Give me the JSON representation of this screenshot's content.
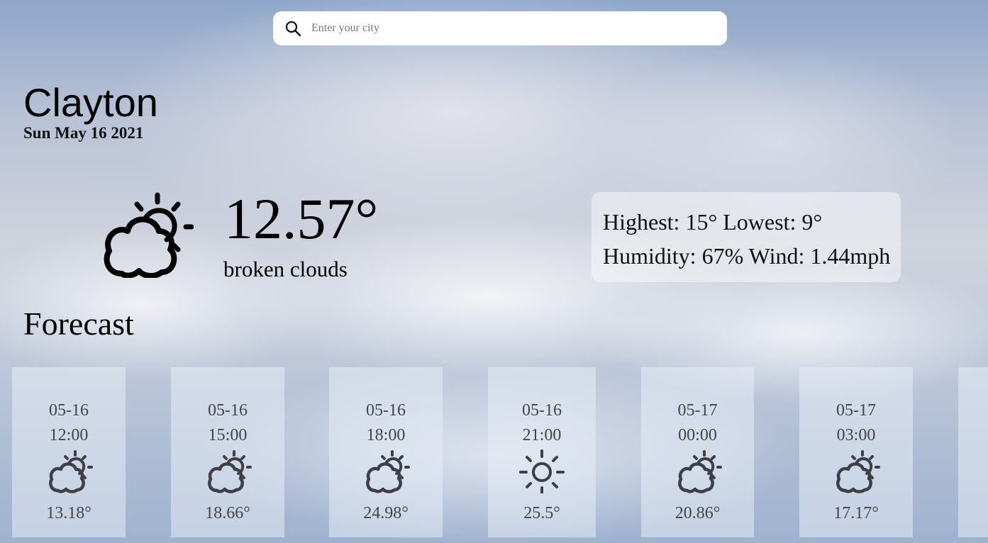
{
  "search": {
    "placeholder": "Enter your city",
    "icon": "search-icon"
  },
  "current": {
    "city": "Clayton",
    "date": "Sun May 16 2021",
    "temperature": "12.57°",
    "description": "broken clouds",
    "icon": "partly-cloudy-icon"
  },
  "stats": {
    "highest_label": "Highest:",
    "highest": "15°",
    "lowest_label": "Lowest:",
    "lowest": "9°",
    "humidity_label": "Humidity:",
    "humidity": "67%",
    "wind_label": "Wind:",
    "wind": "1.44mph"
  },
  "forecast": {
    "title": "Forecast",
    "items": [
      {
        "date": "05-16",
        "time": "12:00",
        "temp": "13.18°",
        "icon": "partly-cloudy-icon"
      },
      {
        "date": "05-16",
        "time": "15:00",
        "temp": "18.66°",
        "icon": "partly-cloudy-icon"
      },
      {
        "date": "05-16",
        "time": "18:00",
        "temp": "24.98°",
        "icon": "partly-cloudy-icon"
      },
      {
        "date": "05-16",
        "time": "21:00",
        "temp": "25.5°",
        "icon": "sun-icon"
      },
      {
        "date": "05-17",
        "time": "00:00",
        "temp": "20.86°",
        "icon": "partly-cloudy-icon"
      },
      {
        "date": "05-17",
        "time": "03:00",
        "temp": "17.17°",
        "icon": "partly-cloudy-icon"
      }
    ]
  }
}
